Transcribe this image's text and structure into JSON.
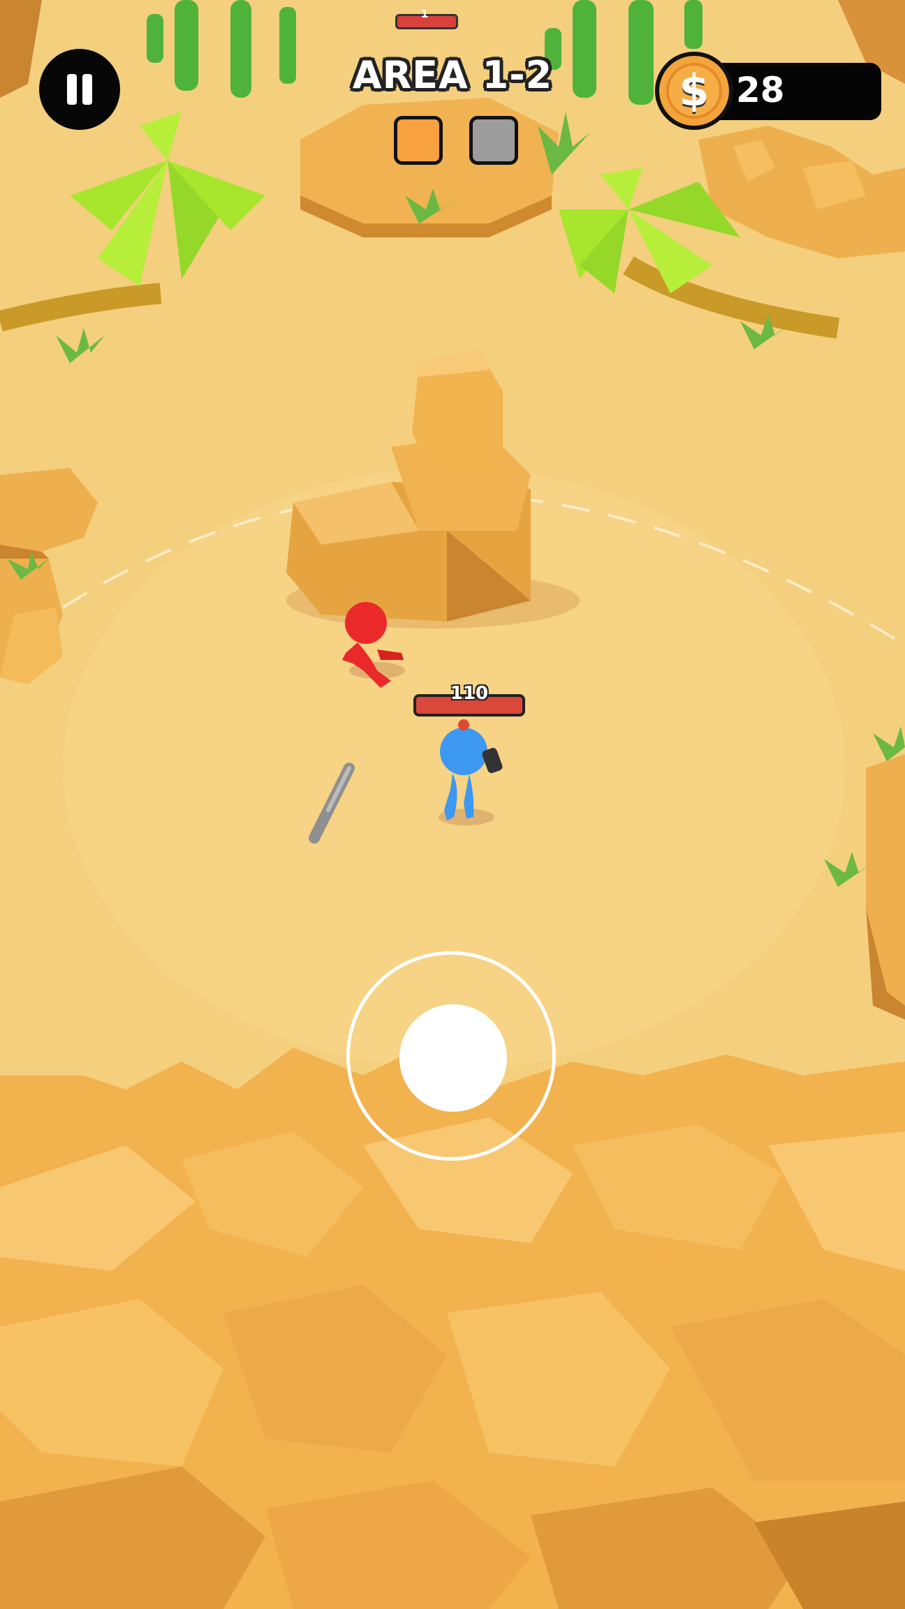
{
  "hud": {
    "area_title": "AREA 1-2",
    "coins": "28",
    "coin_symbol": "$",
    "top_badge": "1",
    "stages": [
      {
        "state": "current",
        "color": "#f7a23f"
      },
      {
        "state": "locked",
        "color": "#9d9d9d"
      }
    ]
  },
  "player": {
    "health": "110",
    "color": "#3d98f1"
  },
  "enemy": {
    "color": "#ea2a2a"
  },
  "icons": {
    "pause": "pause-icon",
    "coin": "dollar-coin-icon",
    "weapon": "baseball-bat-icon"
  },
  "colors": {
    "sand": "#f4cf7e",
    "rock": "#f2b24e",
    "rock_dark": "#c9832b",
    "palm": "#a8e62e",
    "cactus": "#4fb33b"
  }
}
